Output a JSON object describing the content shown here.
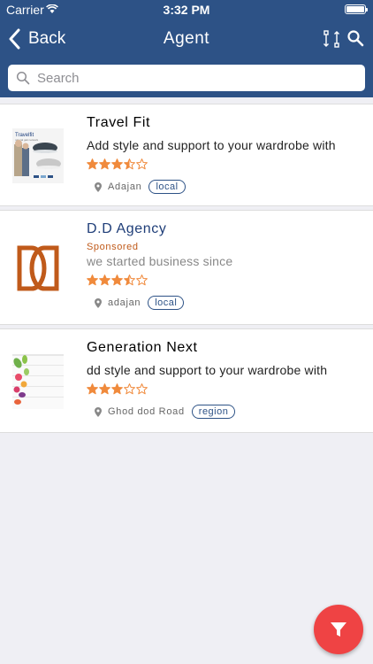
{
  "status_bar": {
    "carrier": "Carrier",
    "time": "3:32 PM"
  },
  "nav": {
    "back_label": "Back",
    "title": "Agent"
  },
  "search": {
    "placeholder": "Search"
  },
  "agents": [
    {
      "title": "Travel Fit",
      "sponsored": "",
      "description": "Add style and support to your wardrobe with",
      "rating": 3.5,
      "location": "Adajan",
      "tag": "local"
    },
    {
      "title": "D.D Agency",
      "sponsored": "Sponsored",
      "description": "we started business since",
      "rating": 3.5,
      "location": "adajan",
      "tag": "local"
    },
    {
      "title": "Generation Next",
      "sponsored": "",
      "description": "dd style and support to your wardrobe with",
      "rating": 3,
      "location": "Ghod dod Road",
      "tag": "region"
    }
  ],
  "thumbnails": {
    "travel_fit_caption": "Travelfit",
    "travel_fit_sub": "natural gait network"
  },
  "colors": {
    "header": "#2d5286",
    "star": "#f08a3c",
    "fab": "#ef4344",
    "tag": "#2d5286"
  },
  "icons": [
    "wifi-icon",
    "battery-icon",
    "back-chevron-icon",
    "swap-icon",
    "search-icon",
    "location-pin-icon",
    "star-icon",
    "filter-icon"
  ]
}
